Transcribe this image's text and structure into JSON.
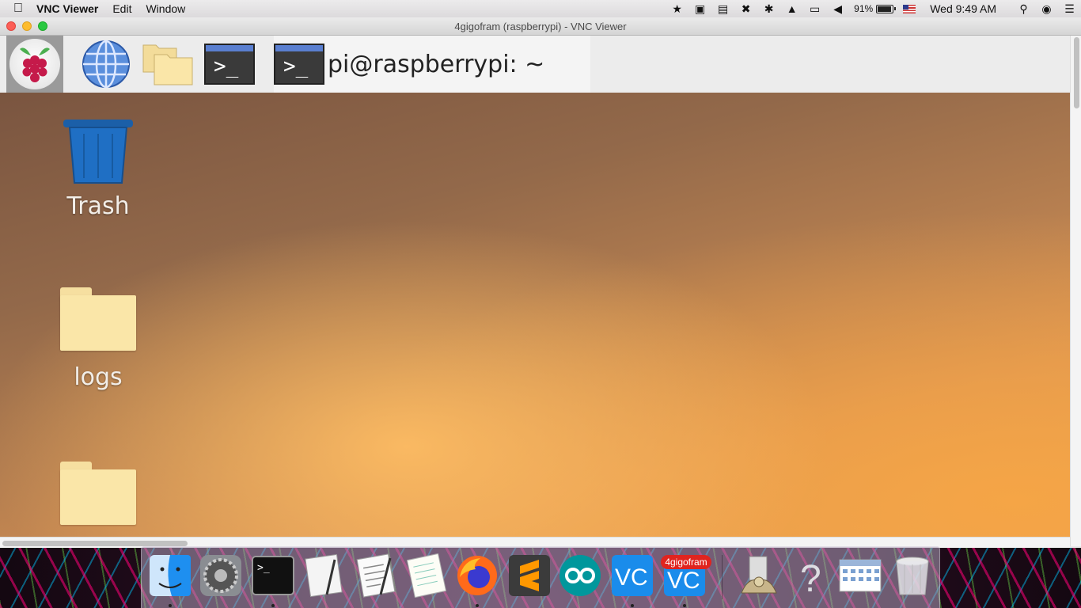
{
  "menubar": {
    "app_name": "VNC Viewer",
    "menus": [
      "Edit",
      "Window"
    ],
    "battery": "91%",
    "clock": "Wed 9:49 AM"
  },
  "window": {
    "title": "4gigofram (raspberrypi) - VNC Viewer"
  },
  "remote": {
    "task_label": "pi@raspberrypi: ~",
    "desktop_icons": [
      {
        "label": "Trash"
      },
      {
        "label": "logs"
      },
      {
        "label": ""
      }
    ]
  },
  "dock": {
    "badge": "4gigofram",
    "items": [
      "finder-icon",
      "system-preferences-icon",
      "terminal-icon",
      "preview-icon",
      "textedit-icon",
      "notes-icon",
      "firefox-icon",
      "sublime-text-icon",
      "arduino-icon",
      "vnc-viewer-icon",
      "vnc-viewer-window-icon",
      "file-uploader-icon",
      "help-icon",
      "calendar-icon",
      "trash-icon"
    ]
  },
  "colors": {
    "desktop_light": "#eaa050",
    "desktop_dark": "#7a5540",
    "vnc_blue": "#1a8ceb",
    "badge_red": "#e0241f"
  }
}
